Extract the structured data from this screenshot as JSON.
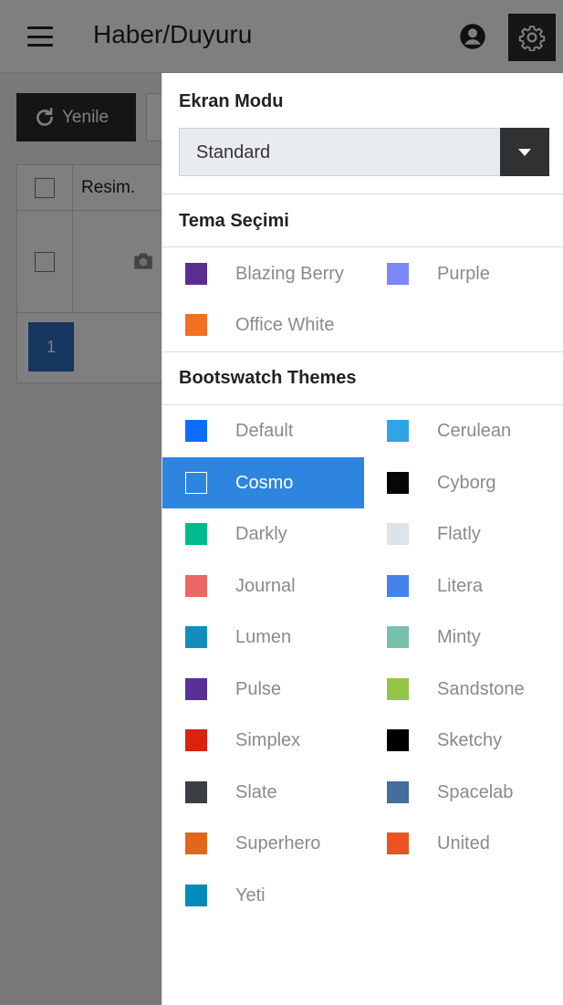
{
  "header": {
    "title": "Haber/Duyuru"
  },
  "toolbar": {
    "refresh_label": "Yenile"
  },
  "grid": {
    "column_image": "Resim.",
    "page_number": "1"
  },
  "settings": {
    "screen_mode": {
      "title": "Ekran Modu",
      "selected": "Standard"
    },
    "theme_selection": {
      "title": "Tema Seçimi",
      "items": [
        {
          "label": "Blazing Berry",
          "color": "#5c2d91"
        },
        {
          "label": "Purple",
          "color": "#7b86f7"
        },
        {
          "label": "Office White",
          "color": "#f27122"
        }
      ]
    },
    "bootswatch": {
      "title": "Bootswatch Themes",
      "selected": "Cosmo",
      "items": [
        {
          "label": "Default",
          "color": "#0d6efd"
        },
        {
          "label": "Cerulean",
          "color": "#2fa4e7"
        },
        {
          "label": "Cosmo",
          "color": "#2780e3"
        },
        {
          "label": "Cyborg",
          "color": "#060606"
        },
        {
          "label": "Darkly",
          "color": "#00bc8c"
        },
        {
          "label": "Flatly",
          "color": "#dee2e9"
        },
        {
          "label": "Journal",
          "color": "#eb6864"
        },
        {
          "label": "Litera",
          "color": "#4582ec"
        },
        {
          "label": "Lumen",
          "color": "#158cba"
        },
        {
          "label": "Minty",
          "color": "#78c2ad"
        },
        {
          "label": "Pulse",
          "color": "#593196"
        },
        {
          "label": "Sandstone",
          "color": "#93c54b"
        },
        {
          "label": "Simplex",
          "color": "#d9230f"
        },
        {
          "label": "Sketchy",
          "color": "#000000"
        },
        {
          "label": "Slate",
          "color": "#3a3f44"
        },
        {
          "label": "Spacelab",
          "color": "#446e9b"
        },
        {
          "label": "Superhero",
          "color": "#df6919"
        },
        {
          "label": "United",
          "color": "#e95420"
        },
        {
          "label": "Yeti",
          "color": "#008cba"
        }
      ]
    }
  }
}
